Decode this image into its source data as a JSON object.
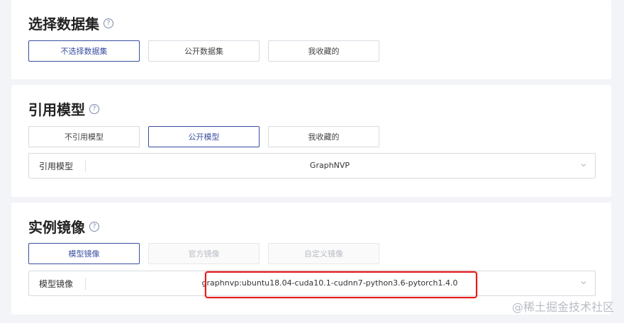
{
  "dataset_section": {
    "title": "选择数据集",
    "help": "?",
    "options": [
      "不选择数据集",
      "公开数据集",
      "我收藏的"
    ],
    "selected_index": 0
  },
  "model_section": {
    "title": "引用模型",
    "help": "?",
    "options": [
      "不引用模型",
      "公开模型",
      "我收藏的"
    ],
    "selected_index": 1,
    "select": {
      "label": "引用模型",
      "value": "GraphNVP"
    }
  },
  "image_section": {
    "title": "实例镜像",
    "help": "?",
    "options": [
      "模型镜像",
      "官方镜像",
      "自定义镜像"
    ],
    "selected_index": 0,
    "select": {
      "label": "模型镜像",
      "value": "graphnvp:ubuntu18.04-cuda10.1-cudnn7-python3.6-pytorch1.4.0"
    }
  },
  "highlight_color": "#e31b1b",
  "accent_color": "#3a4ea0",
  "watermark": "@稀土掘金技术社区"
}
